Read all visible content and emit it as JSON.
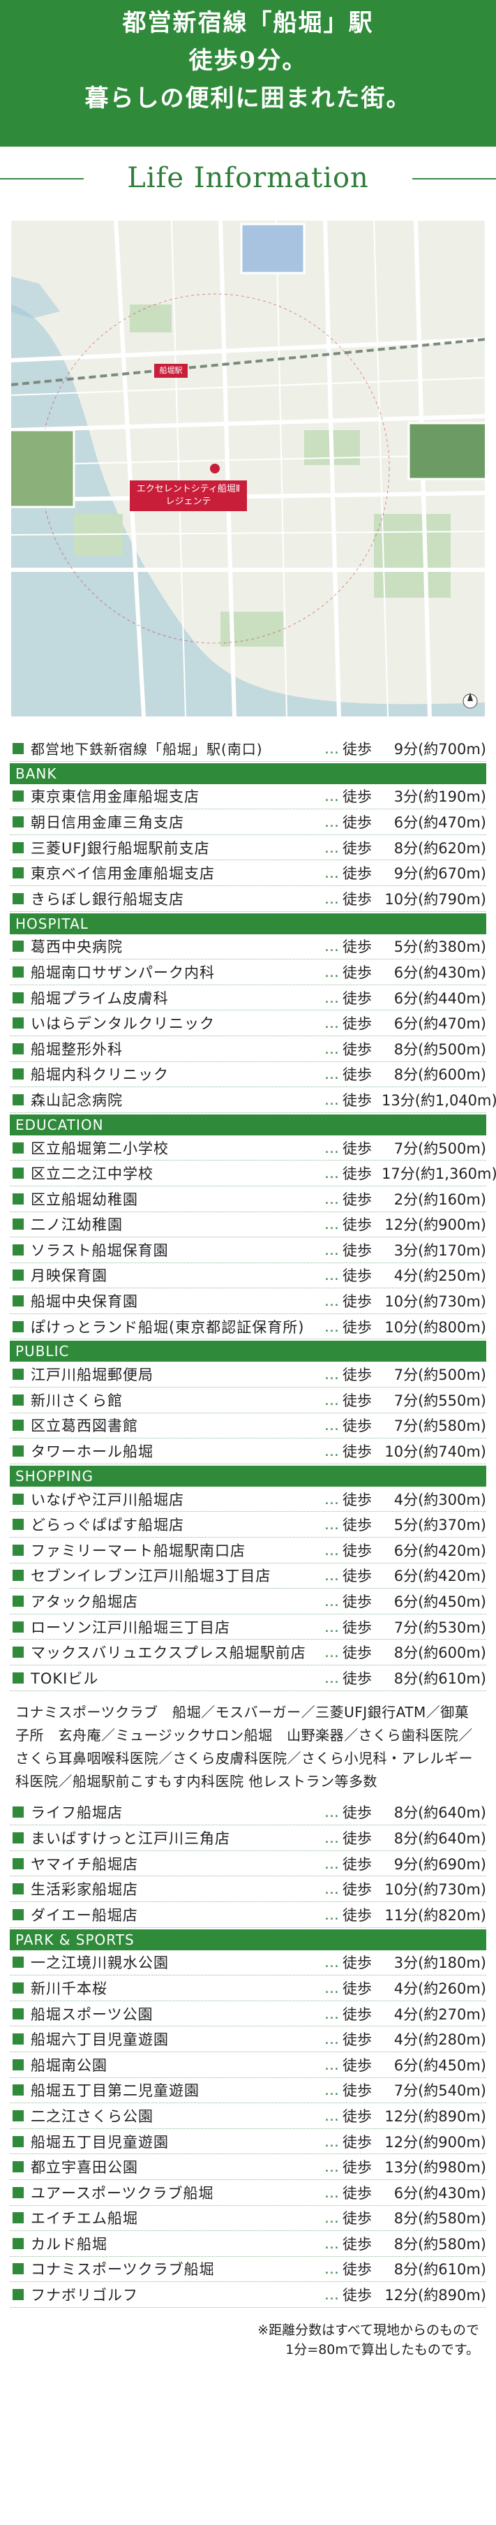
{
  "hero": {
    "line1": "都営新宿線「船堀」駅",
    "line2": "徒歩9分。",
    "line3": "暮らしの便利に囲まれた街。"
  },
  "section_title": "Life Information",
  "map": {
    "station_label": "船堀駅",
    "site_label_1": "エクセレントシティ船堀Ⅱ",
    "site_label_2": "レジェンテ",
    "colors": {
      "land": "#eef0e8",
      "road": "#ffffff",
      "park": "#c9dfc0",
      "river": "#9ec6d6",
      "accent": "#c81e3a"
    }
  },
  "top_row": {
    "name": "都営地下鉄新宿線「船堀」駅(南口)",
    "mode": "徒歩",
    "dist": "9分(約700m)"
  },
  "categories": [
    {
      "title": "BANK",
      "rows": [
        {
          "name": "東京東信用金庫船堀支店",
          "mode": "徒歩",
          "dist": "3分(約190m)"
        },
        {
          "name": "朝日信用金庫三角支店",
          "mode": "徒歩",
          "dist": "6分(約470m)"
        },
        {
          "name": "三菱UFJ銀行船堀駅前支店",
          "mode": "徒歩",
          "dist": "8分(約620m)"
        },
        {
          "name": "東京ベイ信用金庫船堀支店",
          "mode": "徒歩",
          "dist": "9分(約670m)"
        },
        {
          "name": "きらぼし銀行船堀支店",
          "mode": "徒歩",
          "dist": "10分(約790m)"
        }
      ]
    },
    {
      "title": "HOSPITAL",
      "rows": [
        {
          "name": "葛西中央病院",
          "mode": "徒歩",
          "dist": "5分(約380m)"
        },
        {
          "name": "船堀南口サザンパーク内科",
          "mode": "徒歩",
          "dist": "6分(約430m)"
        },
        {
          "name": "船堀プライム皮膚科",
          "mode": "徒歩",
          "dist": "6分(約440m)"
        },
        {
          "name": "いはらデンタルクリニック",
          "mode": "徒歩",
          "dist": "6分(約470m)"
        },
        {
          "name": "船堀整形外科",
          "mode": "徒歩",
          "dist": "8分(約500m)"
        },
        {
          "name": "船堀内科クリニック",
          "mode": "徒歩",
          "dist": "8分(約600m)"
        },
        {
          "name": "森山記念病院",
          "mode": "徒歩",
          "dist": "13分(約1,040m)"
        }
      ]
    },
    {
      "title": "EDUCATION",
      "rows": [
        {
          "name": "区立船堀第二小学校",
          "mode": "徒歩",
          "dist": "7分(約500m)"
        },
        {
          "name": "区立二之江中学校",
          "mode": "徒歩",
          "dist": "17分(約1,360m)"
        },
        {
          "name": "区立船堀幼稚園",
          "mode": "徒歩",
          "dist": "2分(約160m)"
        },
        {
          "name": "二ノ江幼稚園",
          "mode": "徒歩",
          "dist": "12分(約900m)"
        },
        {
          "name": "ソラスト船堀保育園",
          "mode": "徒歩",
          "dist": "3分(約170m)"
        },
        {
          "name": "月映保育園",
          "mode": "徒歩",
          "dist": "4分(約250m)"
        },
        {
          "name": "船堀中央保育園",
          "mode": "徒歩",
          "dist": "10分(約730m)"
        },
        {
          "name": "ぽけっとランド船堀(東京都認証保育所)",
          "mode": "徒歩",
          "dist": "10分(約800m)"
        }
      ]
    },
    {
      "title": "PUBLIC",
      "rows": [
        {
          "name": "江戸川船堀郵便局",
          "mode": "徒歩",
          "dist": "7分(約500m)"
        },
        {
          "name": "新川さくら館",
          "mode": "徒歩",
          "dist": "7分(約550m)"
        },
        {
          "name": "区立葛西図書館",
          "mode": "徒歩",
          "dist": "7分(約580m)"
        },
        {
          "name": "タワーホール船堀",
          "mode": "徒歩",
          "dist": "10分(約740m)"
        }
      ]
    },
    {
      "title": "SHOPPING",
      "rows": [
        {
          "name": "いなげや江戸川船堀店",
          "mode": "徒歩",
          "dist": "4分(約300m)"
        },
        {
          "name": "どらっぐぱぱす船堀店",
          "mode": "徒歩",
          "dist": "5分(約370m)"
        },
        {
          "name": "ファミリーマート船堀駅南口店",
          "mode": "徒歩",
          "dist": "6分(約420m)"
        },
        {
          "name": "セブンイレブン江戸川船堀3丁目店",
          "mode": "徒歩",
          "dist": "6分(約420m)"
        },
        {
          "name": "アタック船堀店",
          "mode": "徒歩",
          "dist": "6分(約450m)"
        },
        {
          "name": "ローソン江戸川船堀三丁目店",
          "mode": "徒歩",
          "dist": "7分(約530m)"
        },
        {
          "name": "マックスバリュエクスプレス船堀駅前店",
          "mode": "徒歩",
          "dist": "8分(約600m)"
        },
        {
          "name": "TOKIビル",
          "mode": "徒歩",
          "dist": "8分(約610m)"
        }
      ]
    }
  ],
  "shopping_note": "コナミスポーツクラブ　船堀／モスバーガー／三菱UFJ銀行ATM／御菓子所　玄舟庵／ミュージックサロン船堀　山野楽器／さくら歯科医院／さくら耳鼻咽喉科医院／さくら皮膚科医院／さくら小児科・アレルギー科医院／船堀駅前こすもす内科医院 他レストラン等多数",
  "shopping_more": [
    {
      "name": "ライフ船堀店",
      "mode": "徒歩",
      "dist": "8分(約640m)"
    },
    {
      "name": "まいばすけっと江戸川三角店",
      "mode": "徒歩",
      "dist": "8分(約640m)"
    },
    {
      "name": "ヤマイチ船堀店",
      "mode": "徒歩",
      "dist": "9分(約690m)"
    },
    {
      "name": "生活彩家船堀店",
      "mode": "徒歩",
      "dist": "10分(約730m)"
    },
    {
      "name": "ダイエー船堀店",
      "mode": "徒歩",
      "dist": "11分(約820m)"
    }
  ],
  "park": {
    "title": "PARK & SPORTS",
    "rows": [
      {
        "name": "一之江境川親水公園",
        "mode": "徒歩",
        "dist": "3分(約180m)"
      },
      {
        "name": "新川千本桜",
        "mode": "徒歩",
        "dist": "4分(約260m)"
      },
      {
        "name": "船堀スポーツ公園",
        "mode": "徒歩",
        "dist": "4分(約270m)"
      },
      {
        "name": "船堀六丁目児童遊園",
        "mode": "徒歩",
        "dist": "4分(約280m)"
      },
      {
        "name": "船堀南公園",
        "mode": "徒歩",
        "dist": "6分(約450m)"
      },
      {
        "name": "船堀五丁目第二児童遊園",
        "mode": "徒歩",
        "dist": "7分(約540m)"
      },
      {
        "name": "二之江さくら公園",
        "mode": "徒歩",
        "dist": "12分(約890m)"
      },
      {
        "name": "船堀五丁目児童遊園",
        "mode": "徒歩",
        "dist": "12分(約900m)"
      },
      {
        "name": "都立宇喜田公園",
        "mode": "徒歩",
        "dist": "13分(約980m)"
      },
      {
        "name": "ユアースポーツクラブ船堀",
        "mode": "徒歩",
        "dist": "6分(約430m)"
      },
      {
        "name": "エイチエム船堀",
        "mode": "徒歩",
        "dist": "8分(約580m)"
      },
      {
        "name": "カルド船堀",
        "mode": "徒歩",
        "dist": "8分(約580m)"
      },
      {
        "name": "コナミスポーツクラブ船堀",
        "mode": "徒歩",
        "dist": "8分(約610m)"
      },
      {
        "name": "フナボリゴルフ",
        "mode": "徒歩",
        "dist": "12分(約890m)"
      }
    ]
  },
  "footnote_1": "※距離分数はすべて現地からのもので",
  "footnote_2": "1分=80mで算出したものです。"
}
